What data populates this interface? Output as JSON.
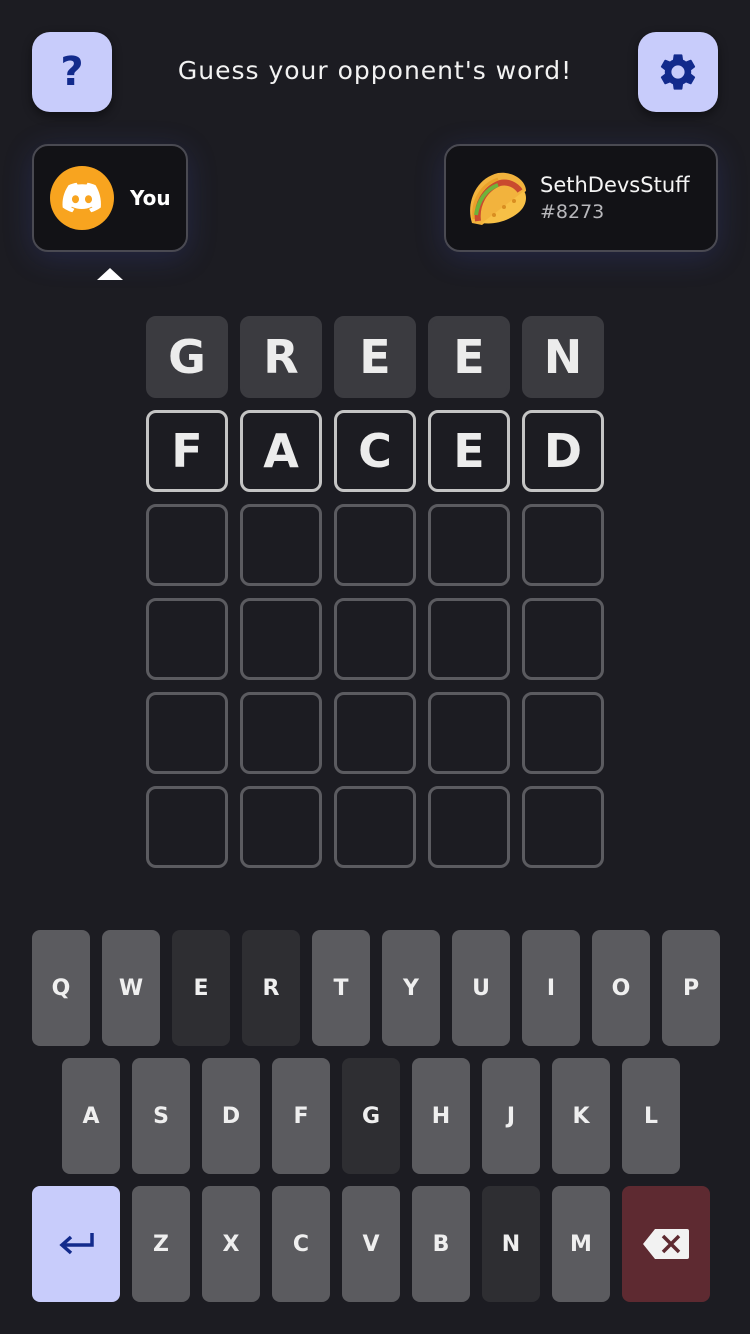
{
  "header": {
    "title": "Guess your opponent's word!",
    "help_icon": "question-mark-icon",
    "settings_icon": "gear-icon",
    "button_color": "#c8ccfb"
  },
  "players": {
    "you": {
      "label": "You",
      "avatar": "discord-logo",
      "avatar_color": "#f8a41f"
    },
    "opponent": {
      "name": "SethDevsStuff",
      "tag": "#8273",
      "avatar": "taco-emoji"
    },
    "active_turn": "you"
  },
  "board": {
    "rows": [
      {
        "state": "guessed",
        "letters": [
          "G",
          "R",
          "E",
          "E",
          "N"
        ]
      },
      {
        "state": "current",
        "letters": [
          "F",
          "A",
          "C",
          "E",
          "D"
        ]
      },
      {
        "state": "empty",
        "letters": [
          "",
          "",
          "",
          "",
          ""
        ]
      },
      {
        "state": "empty",
        "letters": [
          "",
          "",
          "",
          "",
          ""
        ]
      },
      {
        "state": "empty",
        "letters": [
          "",
          "",
          "",
          "",
          ""
        ]
      },
      {
        "state": "empty",
        "letters": [
          "",
          "",
          "",
          "",
          ""
        ]
      }
    ]
  },
  "keyboard": {
    "rows": [
      [
        {
          "label": "Q",
          "state": "unused"
        },
        {
          "label": "W",
          "state": "unused"
        },
        {
          "label": "E",
          "state": "used"
        },
        {
          "label": "R",
          "state": "used"
        },
        {
          "label": "T",
          "state": "unused"
        },
        {
          "label": "Y",
          "state": "unused"
        },
        {
          "label": "U",
          "state": "unused"
        },
        {
          "label": "I",
          "state": "unused"
        },
        {
          "label": "O",
          "state": "unused"
        },
        {
          "label": "P",
          "state": "unused"
        }
      ],
      [
        {
          "label": "A",
          "state": "unused"
        },
        {
          "label": "S",
          "state": "unused"
        },
        {
          "label": "D",
          "state": "unused"
        },
        {
          "label": "F",
          "state": "unused"
        },
        {
          "label": "G",
          "state": "used"
        },
        {
          "label": "H",
          "state": "unused"
        },
        {
          "label": "J",
          "state": "unused"
        },
        {
          "label": "K",
          "state": "unused"
        },
        {
          "label": "L",
          "state": "unused"
        }
      ],
      [
        {
          "label": "",
          "state": "enter",
          "icon": "enter-icon"
        },
        {
          "label": "Z",
          "state": "unused"
        },
        {
          "label": "X",
          "state": "unused"
        },
        {
          "label": "C",
          "state": "unused"
        },
        {
          "label": "V",
          "state": "unused"
        },
        {
          "label": "B",
          "state": "unused"
        },
        {
          "label": "N",
          "state": "used"
        },
        {
          "label": "M",
          "state": "unused"
        },
        {
          "label": "",
          "state": "backspace",
          "icon": "backspace-icon"
        }
      ]
    ],
    "colors": {
      "unused": "#5b5b5f",
      "used": "#2e2e32",
      "enter": "#c8ccfb",
      "backspace": "#5e2a31"
    }
  }
}
